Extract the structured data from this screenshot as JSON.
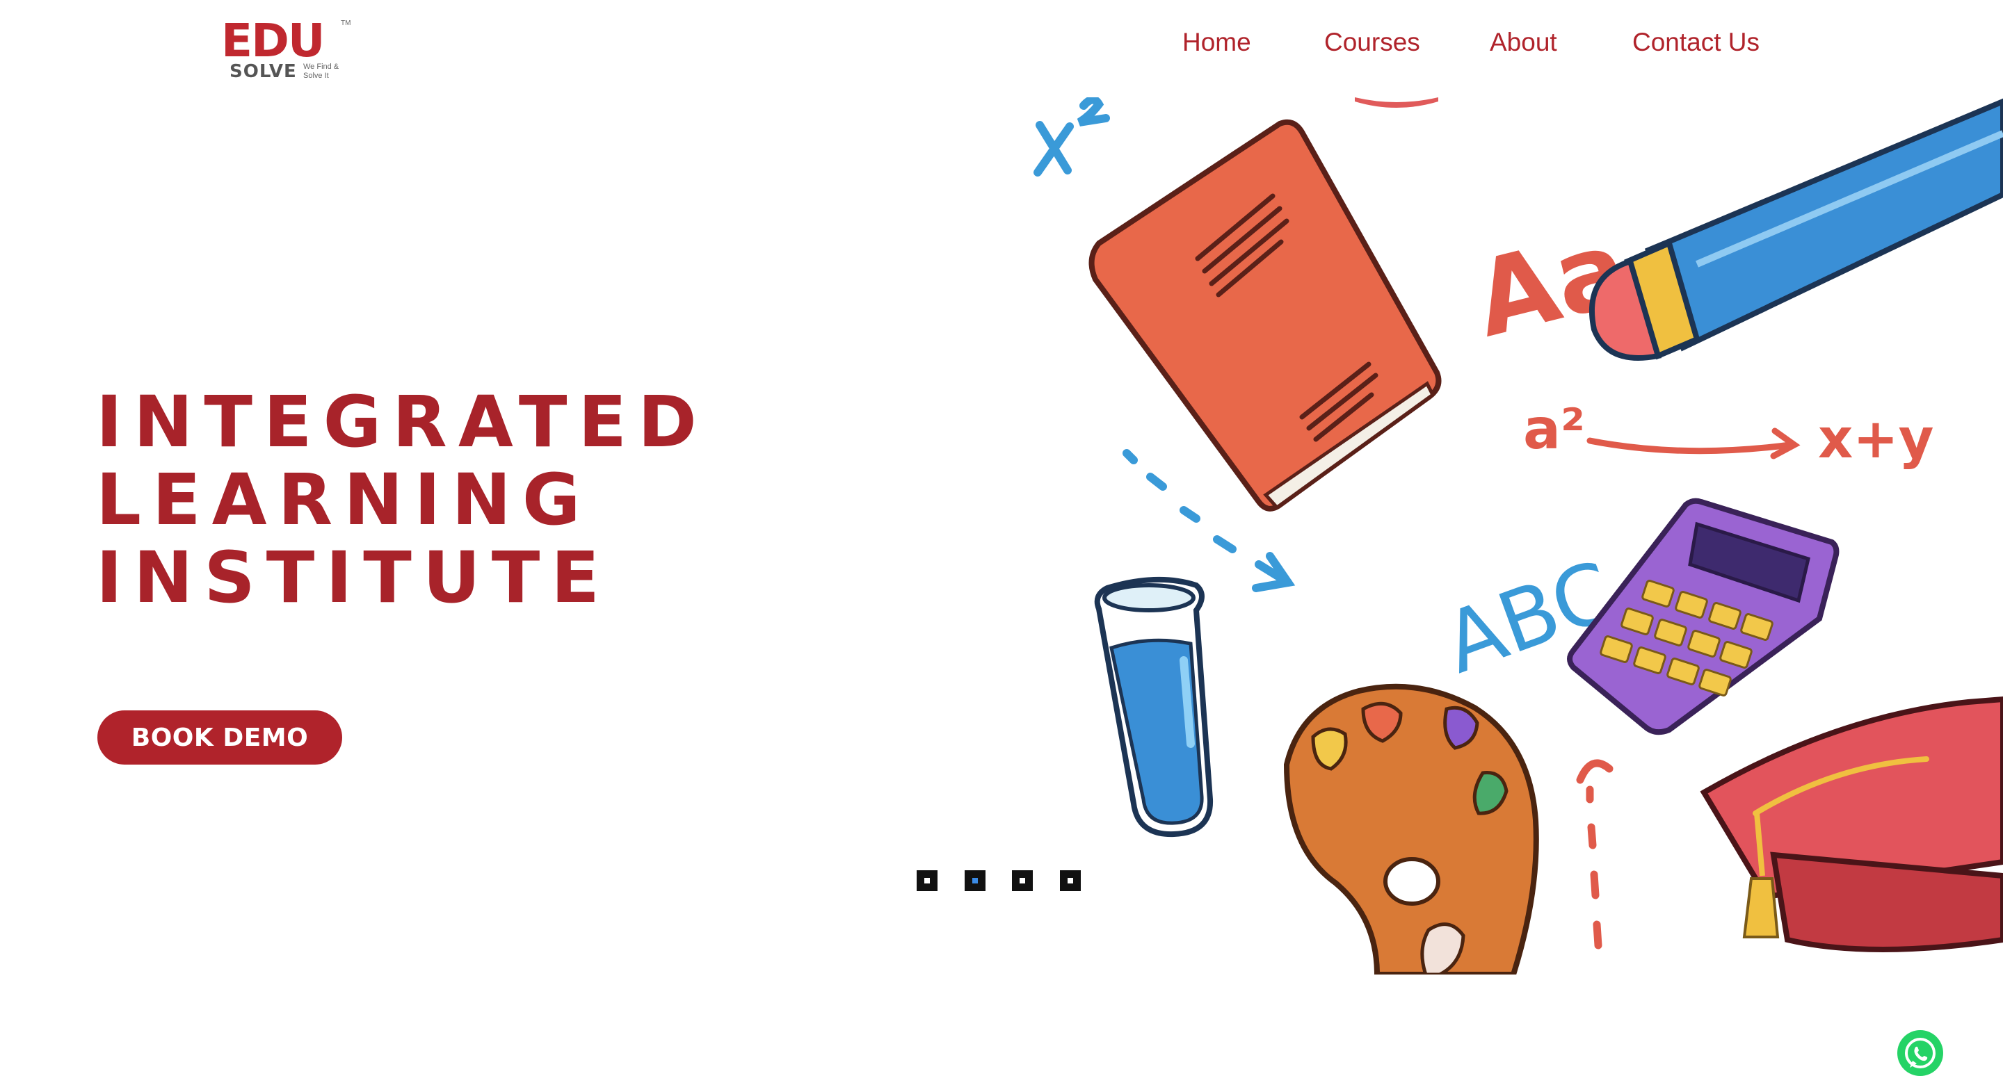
{
  "brand": {
    "logo_text": "EDU",
    "sub_text": "SOLVE",
    "tagline": "We Find & Solve It",
    "trademark": "TM"
  },
  "nav": {
    "items": [
      {
        "label": "Home"
      },
      {
        "label": "Courses"
      },
      {
        "label": "About"
      },
      {
        "label": "Contact Us"
      }
    ]
  },
  "hero": {
    "title_lines": [
      "INTEGRATED",
      "LEARNING",
      "INSTITUTE"
    ],
    "cta_label": "BOOK DEMO",
    "slides": {
      "count": 4,
      "active_index": 2
    }
  },
  "illustration": {
    "text_aa": "Aa",
    "text_abc": "ABC",
    "text_formula_left": "a²",
    "text_formula_right": "x+y",
    "text_x2": "x²"
  },
  "colors": {
    "brand_red": "#b0232b",
    "title_red": "#a8232a",
    "dot_active": "#3b8be6",
    "whatsapp_green": "#25d366"
  },
  "icons": {
    "whatsapp": "whatsapp-icon"
  }
}
